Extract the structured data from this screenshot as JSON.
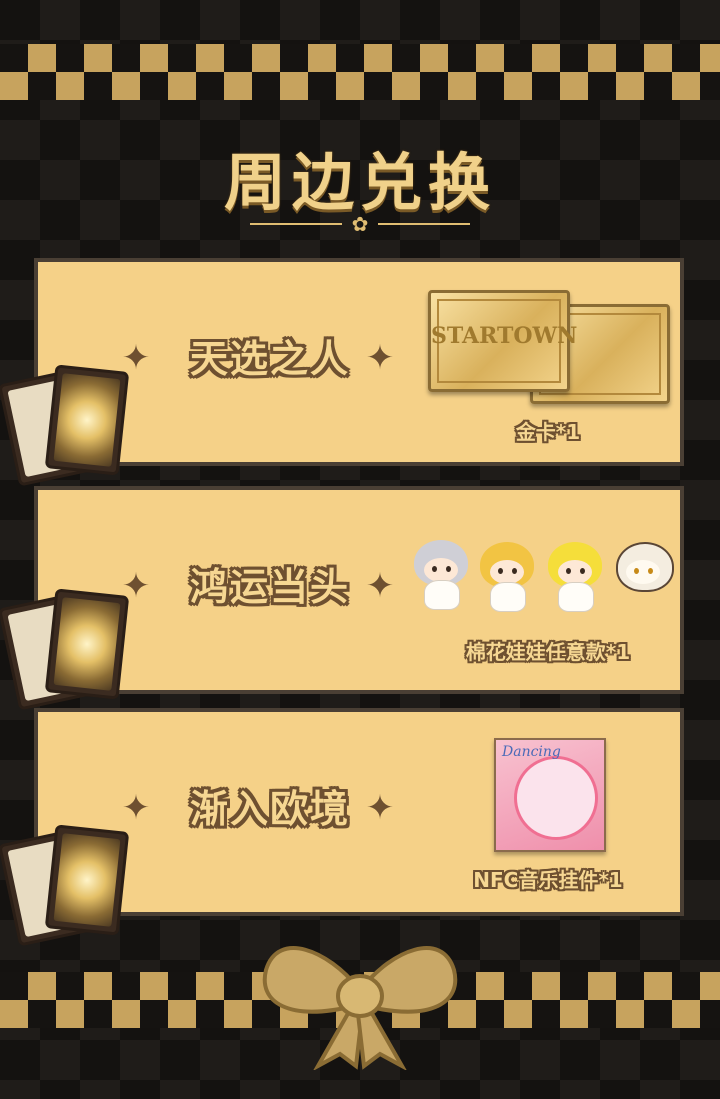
{
  "title": "周边兑换",
  "tiers": [
    {
      "name": "天选之人",
      "prize": "金卡*1"
    },
    {
      "name": "鸿运当头",
      "prize": "棉花娃娃任意款*1"
    },
    {
      "name": "渐入欧境",
      "prize": "NFC音乐挂件*1"
    }
  ],
  "colors": {
    "background": "#141210",
    "checker_gold": "#c7a35e",
    "panel": "#f5d188",
    "panel_border": "#4a3f34",
    "text_outline": "#6e5030",
    "text_fill": "#f6d792"
  },
  "icons": [
    "sparkle-icon",
    "flower-icon",
    "bow-icon",
    "tarot-card-icon"
  ],
  "product_art": {
    "gold_card_logo": "STARTOWN",
    "music_box_label": "Dancing"
  }
}
